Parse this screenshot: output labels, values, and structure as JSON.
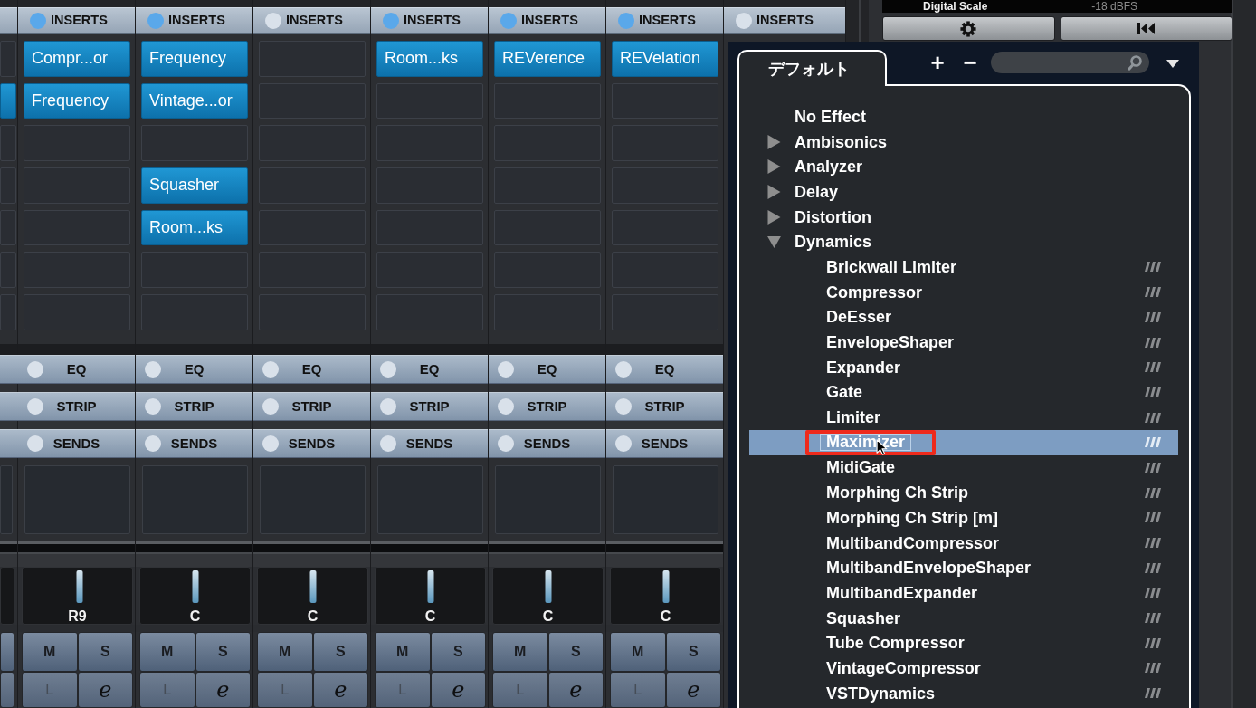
{
  "mixer": {
    "edge_strip": {
      "slots": [
        {
          "filled": false
        },
        {
          "filled": true
        },
        {
          "filled": false
        },
        {
          "filled": false
        },
        {
          "filled": false
        },
        {
          "filled": false
        },
        {
          "filled": false
        }
      ]
    },
    "channels": [
      {
        "inserts": {
          "label": "INSERTS",
          "on": true
        },
        "slots": [
          {
            "filled": true,
            "plugin": "Compr...or"
          },
          {
            "filled": true,
            "plugin": "Frequency"
          },
          {
            "filled": false
          },
          {
            "filled": false
          },
          {
            "filled": false
          },
          {
            "filled": false
          },
          {
            "filled": false
          }
        ],
        "sections": [
          {
            "label": "EQ",
            "on": false
          },
          {
            "label": "STRIP",
            "on": false
          },
          {
            "label": "SENDS",
            "on": false
          }
        ],
        "pan": {
          "label": "R9",
          "level": 0.52
        },
        "buttons": [
          {
            "kind": "mute",
            "label": "M",
            "disabled": false
          },
          {
            "kind": "solo",
            "label": "S",
            "disabled": false
          },
          {
            "kind": "listen",
            "label": "L",
            "disabled": true
          },
          {
            "kind": "edit",
            "label": "e",
            "disabled": false
          }
        ]
      },
      {
        "inserts": {
          "label": "INSERTS",
          "on": true
        },
        "slots": [
          {
            "filled": true,
            "plugin": "Frequency"
          },
          {
            "filled": true,
            "plugin": "Vintage...or"
          },
          {
            "filled": false
          },
          {
            "filled": true,
            "plugin": "Squasher"
          },
          {
            "filled": true,
            "plugin": "Room...ks"
          },
          {
            "filled": false
          },
          {
            "filled": false
          }
        ],
        "sections": [
          {
            "label": "EQ",
            "on": false
          },
          {
            "label": "STRIP",
            "on": false
          },
          {
            "label": "SENDS",
            "on": false
          }
        ],
        "pan": {
          "label": "C",
          "level": 0.5
        },
        "buttons": [
          {
            "kind": "mute",
            "label": "M",
            "disabled": false
          },
          {
            "kind": "solo",
            "label": "S",
            "disabled": false
          },
          {
            "kind": "listen",
            "label": "L",
            "disabled": true
          },
          {
            "kind": "edit",
            "label": "e",
            "disabled": false
          }
        ]
      },
      {
        "inserts": {
          "label": "INSERTS",
          "on": false
        },
        "slots": [
          {
            "filled": false
          },
          {
            "filled": false
          },
          {
            "filled": false
          },
          {
            "filled": false
          },
          {
            "filled": false
          },
          {
            "filled": false
          },
          {
            "filled": false
          }
        ],
        "sections": [
          {
            "label": "EQ",
            "on": false
          },
          {
            "label": "STRIP",
            "on": false
          },
          {
            "label": "SENDS",
            "on": false
          }
        ],
        "pan": {
          "label": "C",
          "level": 0.5
        },
        "buttons": [
          {
            "kind": "mute",
            "label": "M",
            "disabled": false
          },
          {
            "kind": "solo",
            "label": "S",
            "disabled": false
          },
          {
            "kind": "listen",
            "label": "L",
            "disabled": true
          },
          {
            "kind": "edit",
            "label": "e",
            "disabled": false
          }
        ]
      },
      {
        "inserts": {
          "label": "INSERTS",
          "on": true
        },
        "slots": [
          {
            "filled": true,
            "plugin": "Room...ks"
          },
          {
            "filled": false
          },
          {
            "filled": false
          },
          {
            "filled": false
          },
          {
            "filled": false
          },
          {
            "filled": false
          },
          {
            "filled": false
          }
        ],
        "sections": [
          {
            "label": "EQ",
            "on": false
          },
          {
            "label": "STRIP",
            "on": false
          },
          {
            "label": "SENDS",
            "on": false
          }
        ],
        "pan": {
          "label": "C",
          "level": 0.5
        },
        "buttons": [
          {
            "kind": "mute",
            "label": "M",
            "disabled": false
          },
          {
            "kind": "solo",
            "label": "S",
            "disabled": false
          },
          {
            "kind": "listen",
            "label": "L",
            "disabled": true
          },
          {
            "kind": "edit",
            "label": "e",
            "disabled": false
          }
        ]
      },
      {
        "inserts": {
          "label": "INSERTS",
          "on": true
        },
        "slots": [
          {
            "filled": true,
            "plugin": "REVerence"
          },
          {
            "filled": false
          },
          {
            "filled": false
          },
          {
            "filled": false
          },
          {
            "filled": false
          },
          {
            "filled": false
          },
          {
            "filled": false
          }
        ],
        "sections": [
          {
            "label": "EQ",
            "on": false
          },
          {
            "label": "STRIP",
            "on": false
          },
          {
            "label": "SENDS",
            "on": false
          }
        ],
        "pan": {
          "label": "C",
          "level": 0.5
        },
        "buttons": [
          {
            "kind": "mute",
            "label": "M",
            "disabled": false
          },
          {
            "kind": "solo",
            "label": "S",
            "disabled": false
          },
          {
            "kind": "listen",
            "label": "L",
            "disabled": true
          },
          {
            "kind": "edit",
            "label": "e",
            "disabled": false
          }
        ]
      },
      {
        "inserts": {
          "label": "INSERTS",
          "on": true
        },
        "slots": [
          {
            "filled": true,
            "plugin": "REVelation"
          },
          {
            "filled": false
          },
          {
            "filled": false
          },
          {
            "filled": false
          },
          {
            "filled": false
          },
          {
            "filled": false
          },
          {
            "filled": false
          }
        ],
        "sections": [
          {
            "label": "EQ",
            "on": false
          },
          {
            "label": "STRIP",
            "on": false
          },
          {
            "label": "SENDS",
            "on": false
          }
        ],
        "pan": {
          "label": "C",
          "level": 0.5
        },
        "buttons": [
          {
            "kind": "mute",
            "label": "M",
            "disabled": false
          },
          {
            "kind": "solo",
            "label": "S",
            "disabled": false
          },
          {
            "kind": "listen",
            "label": "L",
            "disabled": true
          },
          {
            "kind": "edit",
            "label": "e",
            "disabled": false
          }
        ]
      },
      {
        "inserts": {
          "label": "INSERTS",
          "on": false
        }
      }
    ]
  },
  "meter_panel": {
    "scale_name": "Digital Scale",
    "scale_value": "-18 dBFS"
  },
  "plugin_browser": {
    "tabs": [
      {
        "label": "デフォルト",
        "selected": true
      }
    ],
    "toolbar": [
      {
        "kind": "add",
        "label": "+"
      },
      {
        "kind": "remove",
        "label": "−"
      }
    ],
    "tree": [
      {
        "kind": "option",
        "label": "No Effect",
        "selected": false
      },
      {
        "kind": "folder",
        "label": "Ambisonics",
        "expanded": false,
        "selected": false
      },
      {
        "kind": "folder",
        "label": "Analyzer",
        "expanded": false,
        "selected": false
      },
      {
        "kind": "folder",
        "label": "Delay",
        "expanded": false,
        "selected": false
      },
      {
        "kind": "folder",
        "label": "Distortion",
        "expanded": false,
        "selected": false
      },
      {
        "kind": "folder",
        "label": "Dynamics",
        "expanded": true,
        "selected": false,
        "children": [
          {
            "kind": "plugin",
            "label": "Brickwall Limiter",
            "selected": false,
            "callout": false
          },
          {
            "kind": "plugin",
            "label": "Compressor",
            "selected": false,
            "callout": false
          },
          {
            "kind": "plugin",
            "label": "DeEsser",
            "selected": false,
            "callout": false
          },
          {
            "kind": "plugin",
            "label": "EnvelopeShaper",
            "selected": false,
            "callout": false
          },
          {
            "kind": "plugin",
            "label": "Expander",
            "selected": false,
            "callout": false
          },
          {
            "kind": "plugin",
            "label": "Gate",
            "selected": false,
            "callout": false
          },
          {
            "kind": "plugin",
            "label": "Limiter",
            "selected": false,
            "callout": false
          },
          {
            "kind": "plugin",
            "label": "Maximizer",
            "selected": true,
            "callout": true
          },
          {
            "kind": "plugin",
            "label": "MidiGate",
            "selected": false,
            "callout": false
          },
          {
            "kind": "plugin",
            "label": "Morphing Ch Strip",
            "selected": false,
            "callout": false
          },
          {
            "kind": "plugin",
            "label": "Morphing Ch Strip [m]",
            "selected": false,
            "callout": false
          },
          {
            "kind": "plugin",
            "label": "MultibandCompressor",
            "selected": false,
            "callout": false
          },
          {
            "kind": "plugin",
            "label": "MultibandEnvelopeShaper",
            "selected": false,
            "callout": false
          },
          {
            "kind": "plugin",
            "label": "MultibandExpander",
            "selected": false,
            "callout": false
          },
          {
            "kind": "plugin",
            "label": "Squasher",
            "selected": false,
            "callout": false
          },
          {
            "kind": "plugin",
            "label": "Tube Compressor",
            "selected": false,
            "callout": false
          },
          {
            "kind": "plugin",
            "label": "VintageCompressor",
            "selected": false,
            "callout": false
          },
          {
            "kind": "plugin",
            "label": "VSTDynamics",
            "selected": false,
            "callout": false
          }
        ]
      }
    ]
  }
}
